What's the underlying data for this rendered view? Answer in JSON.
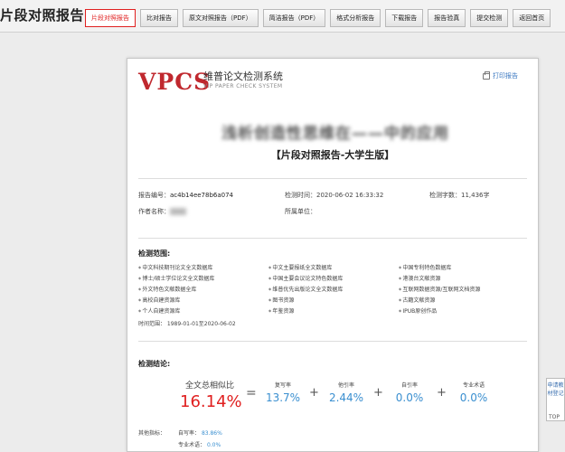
{
  "app": {
    "title": "片段对照报告"
  },
  "tabs": [
    {
      "label": "片段对照报告",
      "active": true
    },
    {
      "label": "比对报告"
    },
    {
      "label": "原文对照报告（PDF）"
    },
    {
      "label": "简洁报告（PDF）"
    },
    {
      "label": "格式分析报告"
    },
    {
      "label": "下载报告"
    },
    {
      "label": "报告验真"
    },
    {
      "label": "提交检测"
    },
    {
      "label": "返回首页"
    }
  ],
  "report": {
    "logo_text": "VPCS",
    "brand_cn": "维普论文检测系统",
    "brand_en": "VIP PAPER CHECK SYSTEM",
    "print_label": "打印报告",
    "doc_title": "浅析创造性思维在——中的应用",
    "report_type": "【片段对照报告-大学生版】",
    "meta": {
      "report_no_label": "报告编号：",
      "report_no": "ac4b14ee78b6a074",
      "check_time_label": "检测时间：",
      "check_time": "2020-06-02 16:33:32",
      "word_count_label": "检测字数：",
      "word_count": "11,436字",
      "author_label": "作者名称：",
      "unit_label": "所属单位："
    },
    "scope": {
      "title": "检测范围:",
      "items": [
        "中文科技期刊论文全文数据库",
        "中文主要报纸全文数据库",
        "中国专利特色数据库",
        "博士/硕士学位论文全文数据库",
        "中国主要会议论文特色数据库",
        "港澳台文献资源",
        "外文特色文献数据全库",
        "维普优先出版论文全文数据库",
        "互联网数据资源/互联网文档资源",
        "高校自建资源库",
        "图书资源",
        "古籍文献资源",
        "个人自建资源库",
        "年鉴资源",
        "IPUB原创作品"
      ],
      "time_range": "时间范围：  1989-01-01至2020-06-02"
    },
    "conclusion": {
      "title": "检测结论:",
      "total_label": "全文总相似比",
      "total_value": "16.14%",
      "metrics": [
        {
          "label": "复写率",
          "value": "13.7%"
        },
        {
          "label": "他引率",
          "value": "2.44%"
        },
        {
          "label": "自引率",
          "value": "0.0%"
        },
        {
          "label": "专业术语",
          "value": "0.0%"
        }
      ],
      "other_label": "其他指标：",
      "other": [
        {
          "label": "自写率：",
          "value": "83.86%"
        },
        {
          "label": "专业术语：",
          "value": "0.0%"
        }
      ]
    }
  },
  "side": {
    "apply_label": "申请教材登记",
    "top_label": "TOP"
  }
}
